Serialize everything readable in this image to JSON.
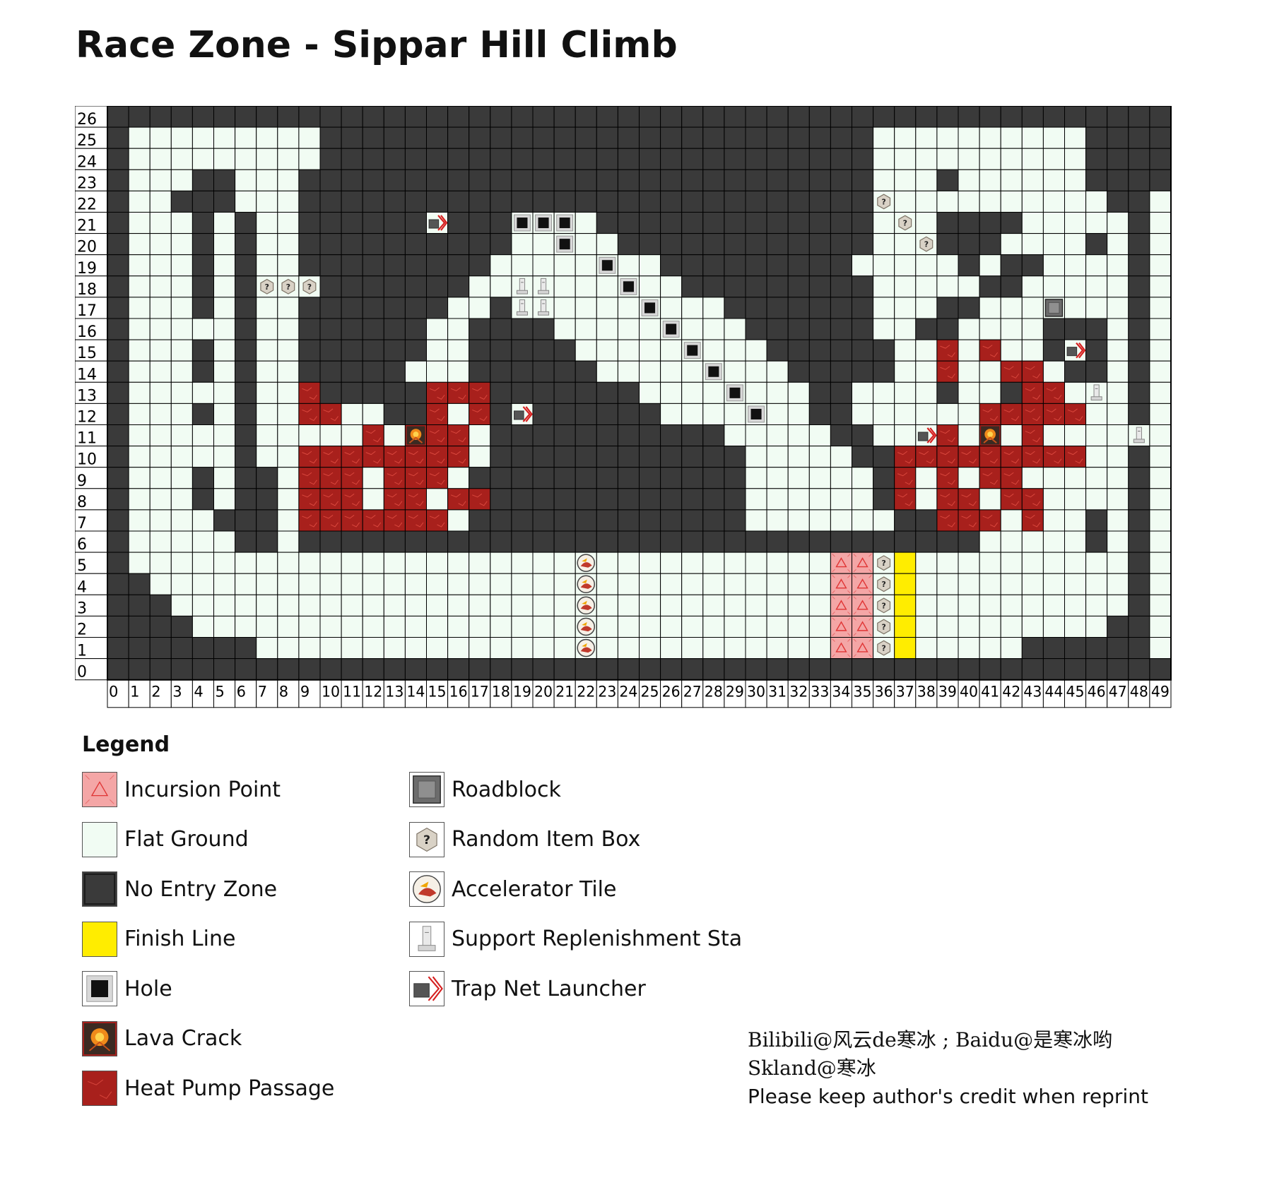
{
  "title": "Race Zone - Sippar Hill Climb",
  "legend_title": "Legend",
  "legend": [
    {
      "key": "incursion",
      "label": "Incursion Point",
      "icon": "incursion-point-icon"
    },
    {
      "key": "flat",
      "label": "Flat Ground",
      "icon": "flat-ground-icon"
    },
    {
      "key": "noentry",
      "label": "No Entry Zone",
      "icon": "no-entry-zone-icon"
    },
    {
      "key": "finish",
      "label": "Finish Line",
      "icon": "finish-line-icon"
    },
    {
      "key": "hole",
      "label": "Hole",
      "icon": "hole-icon"
    },
    {
      "key": "lava",
      "label": "Lava Crack",
      "icon": "lava-crack-icon"
    },
    {
      "key": "heat",
      "label": "Heat Pump Passage",
      "icon": "heat-pump-passage-icon"
    },
    {
      "key": "roadblock",
      "label": "Roadblock",
      "icon": "roadblock-icon"
    },
    {
      "key": "itembox",
      "label": "Random Item Box",
      "icon": "random-item-box-icon"
    },
    {
      "key": "accel",
      "label": "Accelerator Tile",
      "icon": "accelerator-tile-icon"
    },
    {
      "key": "support",
      "label": "Support Replenishment Sta",
      "icon": "support-station-icon"
    },
    {
      "key": "trap",
      "label": "Trap Net Launcher",
      "icon": "trap-net-launcher-icon"
    }
  ],
  "credits": {
    "line1": "Bilibili@风云de寒冰 ; Baidu@是寒冰哟",
    "line2": "Skland@寒冰",
    "line3": "Please keep author's credit when reprint"
  },
  "colors": {
    "flat": "#f1fcf3",
    "noentry": "#3a3a3a",
    "heat": "#a8201c",
    "finish": "#ffed00",
    "incursion": "#f4a6a6",
    "hole": "#111111",
    "grid_line": "#000000"
  },
  "grid": {
    "cols": 50,
    "rows": 27,
    "col_labels": [
      "0",
      "1",
      "2",
      "3",
      "4",
      "5",
      "6",
      "7",
      "8",
      "9",
      "10",
      "11",
      "12",
      "13",
      "14",
      "15",
      "16",
      "17",
      "18",
      "19",
      "20",
      "21",
      "22",
      "23",
      "24",
      "25",
      "26",
      "27",
      "28",
      "29",
      "30",
      "31",
      "32",
      "33",
      "34",
      "35",
      "36",
      "37",
      "38",
      "39",
      "40",
      "41",
      "42",
      "43",
      "44",
      "45",
      "46",
      "47",
      "48",
      "49"
    ],
    "row_labels": [
      "26",
      "25",
      "24",
      "23",
      "22",
      "21",
      "20",
      "19",
      "18",
      "17",
      "16",
      "15",
      "14",
      "13",
      "12",
      "11",
      "10",
      "9",
      "8",
      "7",
      "6",
      "5",
      "4",
      "3",
      "2",
      "1",
      "0"
    ],
    "legend_codes": {
      "#": "No Entry Zone",
      ".": "Flat Ground",
      "H": "Heat Pump Passage",
      "F": "Finish Line",
      "I": "Incursion Point",
      "o": "Hole",
      "?": "Random Item Box",
      "A": "Accelerator Tile",
      "S": "Support Replenishment Sta",
      "T": "Trap Net Launcher",
      "L": "Lava Crack",
      "R": "Roadblock"
    },
    "map": [
      "##################################################",
      "#.........##########################..........####",
      "#.........##########################..........####",
      "#...##...###########################...#......####",
      "#..###...###########################?..........##.",
      "#...#.#..######T###ooo.#############.?.####.....#.",
      "#...#.#..##########..o..############..?###....#.#.",
      "#...#.#..#########.....o..#########.....#.##....#.",
      "#...#.#???#######..SS...o..#########.....##.....#.",
      "#...#.#..#######..#SS....o...#######...##...R...#.",
      "#.....#..######..####.....o...######..##....###.#.",
      "#...#.#..######..#####.....o...######..H.H..#T#.#.",
      "#...#.#..#####...######.....o...#####..H..HH.##.#.",
      "#.....#..H#####HHH#######....o...##....#..#HH.S.#.",
      "#...#.#..HH..##H.H#T######....o..##......HHHHH..#.",
      "#.....#.....H.LHH.###########.....##..TH.L.H....S.",
      "#.....#..HHHHHHHH.############.....##HHHHHHHHH..#.",
      "#...#.##.HHH.HHH.#############......#H.H.HH.....#.",
      "#...#.##.HHH.HH.HH############......#H.HH.HH....#.",
      "#....###.HHHHHHH.#############.......##HHH.H..#.#.",
      "#.....##.################################.....#.#.",
      "#.....................A...........II?F..........#.",
      "##....................A...........II?F..........#.",
      "###...................A...........II?F..........#.",
      "####..................A...........II?F.........##.",
      "#######...............A...........II?F.....######.",
      "##################################################"
    ]
  }
}
